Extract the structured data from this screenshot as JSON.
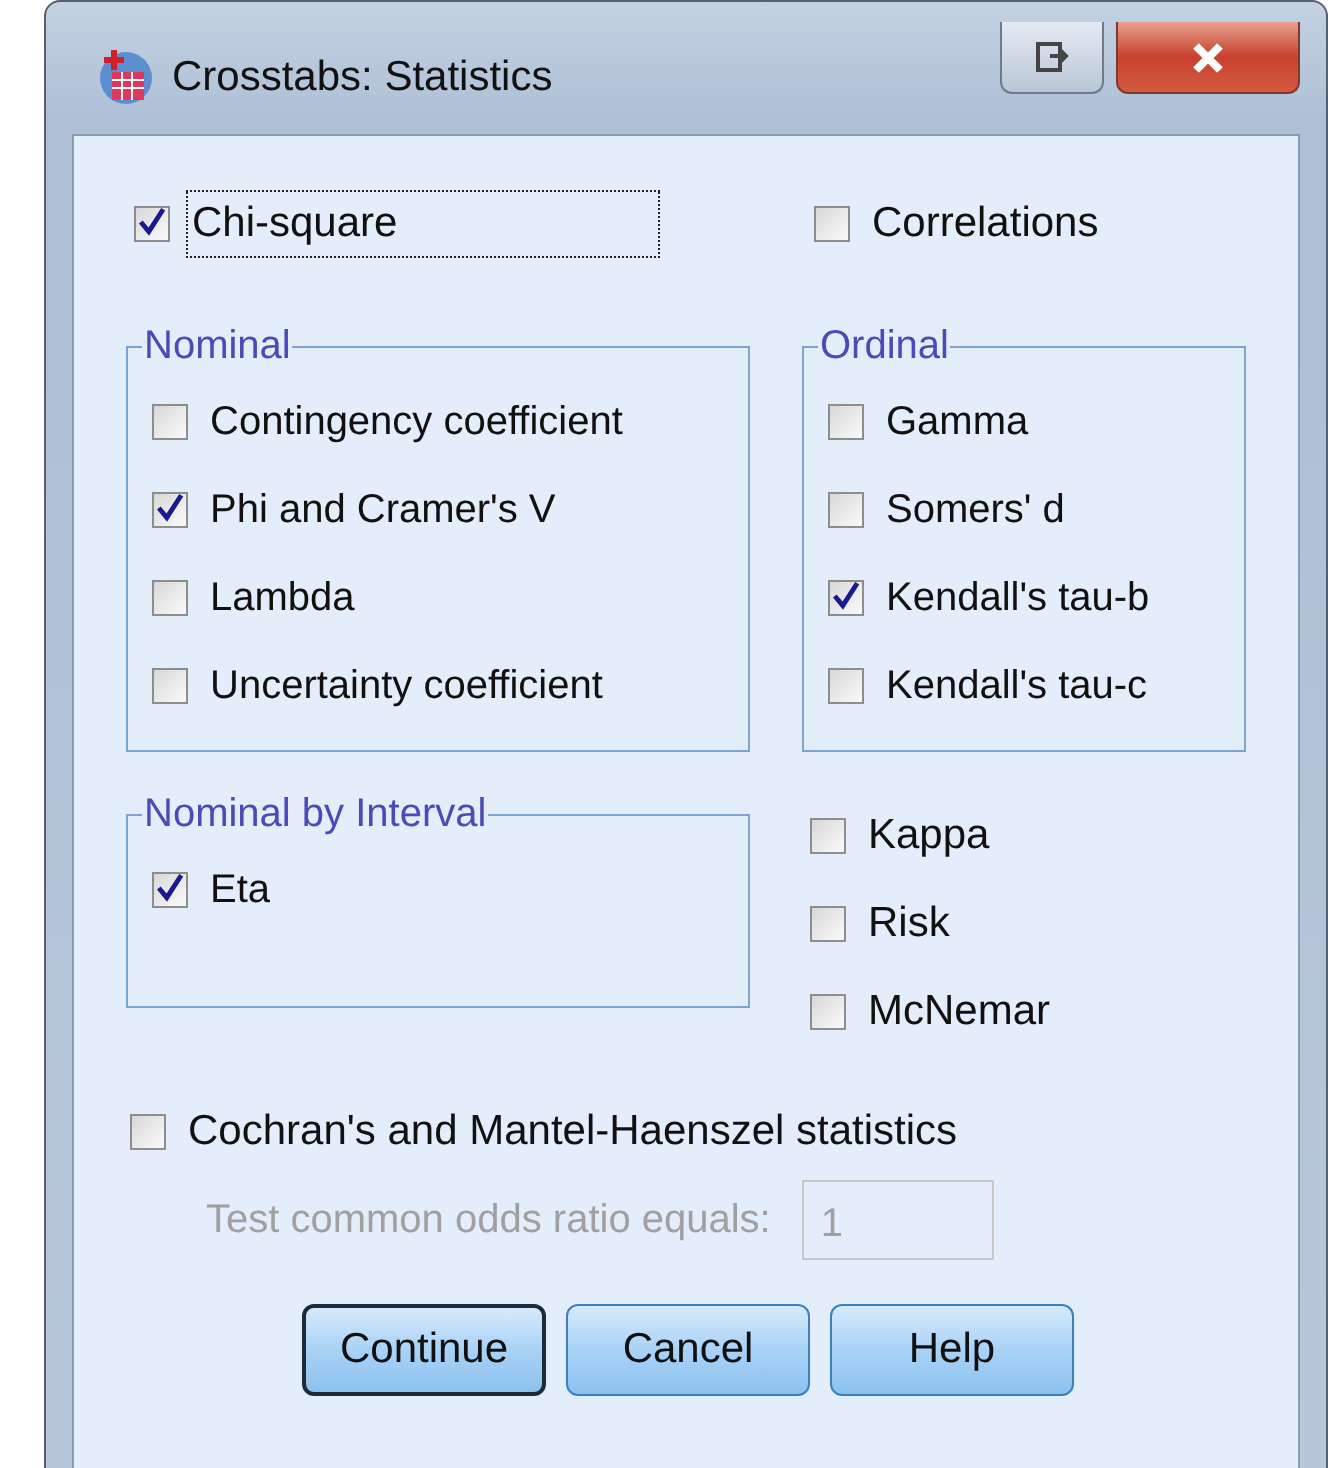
{
  "window": {
    "title": "Crosstabs: Statistics"
  },
  "top_options": [
    {
      "label": "Chi-square",
      "checked": true,
      "focused": true
    },
    {
      "label": "Correlations",
      "checked": false,
      "focused": false
    }
  ],
  "groups": [
    {
      "title": "Nominal",
      "options": [
        {
          "label": "Contingency coefficient",
          "checked": false
        },
        {
          "label": "Phi and Cramer's V",
          "checked": true
        },
        {
          "label": "Lambda",
          "checked": false
        },
        {
          "label": "Uncertainty coefficient",
          "checked": false
        }
      ]
    },
    {
      "title": "Ordinal",
      "options": [
        {
          "label": "Gamma",
          "checked": false
        },
        {
          "label": "Somers' d",
          "checked": false
        },
        {
          "label": "Kendall's tau-b",
          "checked": true
        },
        {
          "label": "Kendall's tau-c",
          "checked": false
        }
      ]
    },
    {
      "title": "Nominal by Interval",
      "options": [
        {
          "label": "Eta",
          "checked": true
        }
      ]
    }
  ],
  "other_options": [
    {
      "label": "Kappa",
      "checked": false
    },
    {
      "label": "Risk",
      "checked": false
    },
    {
      "label": "McNemar",
      "checked": false
    }
  ],
  "cochran": {
    "label": "Cochran's and Mantel-Haenszel statistics",
    "checked": false
  },
  "odds_ratio": {
    "label": "Test common odds ratio equals:",
    "value": "1",
    "disabled": true
  },
  "buttons": [
    {
      "label": "Continue",
      "default": true
    },
    {
      "label": "Cancel",
      "default": false
    },
    {
      "label": "Help",
      "default": false
    }
  ]
}
